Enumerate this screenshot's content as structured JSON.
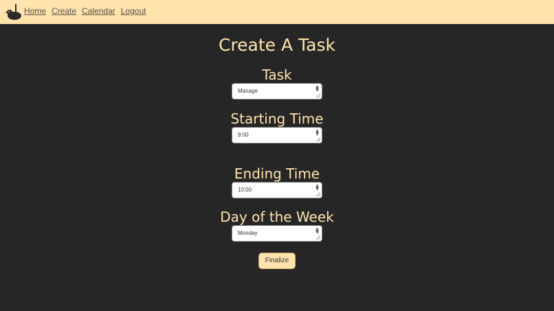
{
  "navbar": {
    "logo_icon": "duck-icon",
    "links": [
      "Home",
      "Create",
      "Calendar",
      "Logout"
    ]
  },
  "page": {
    "title": "Create A Task"
  },
  "form": {
    "task": {
      "label": "Task",
      "value": "Manage"
    },
    "start": {
      "label": "Starting Time",
      "value": "9:00"
    },
    "end": {
      "label": "Ending Time",
      "value": "10:00"
    },
    "day": {
      "label": "Day of the Week",
      "value": "Monday"
    },
    "submit_label": "Finalize"
  },
  "colors": {
    "navbar_bg": "#ffe3ad",
    "page_bg": "#262626",
    "accent_text": "#ffe3ad"
  }
}
